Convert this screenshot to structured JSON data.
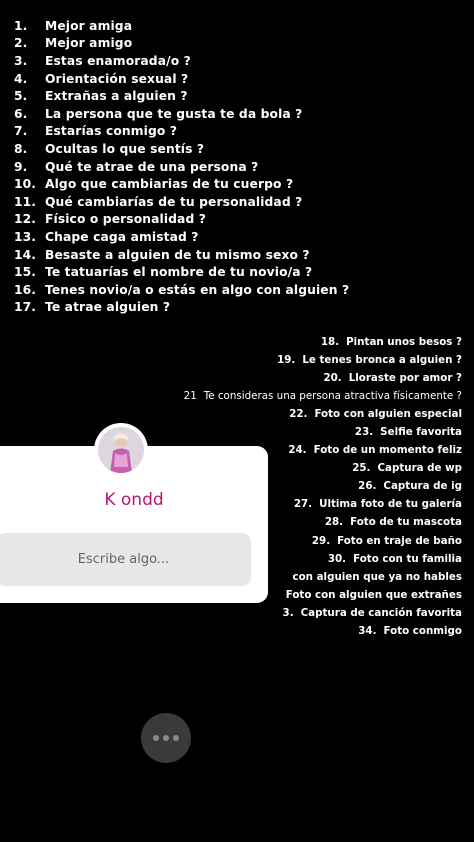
{
  "questions_left": [
    {
      "num": "1.",
      "text": "Mejor amiga"
    },
    {
      "num": "2.",
      "text": "Mejor amigo"
    },
    {
      "num": "3.",
      "text": "Estas enamorada/o ?"
    },
    {
      "num": "4.",
      "text": "Orientación sexual ?"
    },
    {
      "num": "5.",
      "text": "Extrañas a alguien ?"
    },
    {
      "num": "6.",
      "text": "La persona que te gusta te da bola ?"
    },
    {
      "num": "7.",
      "text": "Estarías conmigo ?"
    },
    {
      "num": "8.",
      "text": "Ocultas lo que sentís ?"
    },
    {
      "num": "9.",
      "text": "Qué te atrae de una persona ?"
    },
    {
      "num": "10.",
      "text": "Algo que cambiarias de tu cuerpo ?"
    },
    {
      "num": "11.",
      "text": "Qué cambiarías de tu personalidad ?"
    },
    {
      "num": "12.",
      "text": "Físico o personalidad ?"
    },
    {
      "num": "13.",
      "text": "Chape caga amistad ?"
    },
    {
      "num": "14.",
      "text": "Besaste a alguien de tu mismo sexo ?"
    },
    {
      "num": "15.",
      "text": "Te tatuarías el nombre de tu novio/a ?"
    },
    {
      "num": "16.",
      "text": "Tenes novio/a o estás en algo con alguien ?"
    },
    {
      "num": "17.",
      "text": "Te atrae alguien ?"
    }
  ],
  "questions_right": [
    {
      "num": "18.",
      "text": "Pintan unos besos ?"
    },
    {
      "num": "19.",
      "text": "Le tenes bronca a alguien ?"
    },
    {
      "num": "20.",
      "text": "Lloraste por amor ?"
    },
    {
      "num": "21",
      "text": "Te consideras una persona atractiva físicamente ?"
    },
    {
      "num": "22.",
      "text": "Foto con alguien especial"
    },
    {
      "num": "23.",
      "text": "Selfie favorita"
    },
    {
      "num": "24.",
      "text": "Foto de un momento feliz"
    },
    {
      "num": "25.",
      "text": "Captura de wp"
    },
    {
      "num": "26.",
      "text": "Captura de ig"
    },
    {
      "num": "27.",
      "text": "Ultima foto de tu galería"
    },
    {
      "num": "28.",
      "text": "Foto de tu mascota"
    },
    {
      "num": "29.",
      "text": "Foto en traje de baño"
    },
    {
      "num": "30.",
      "text": "Foto con tu familia"
    },
    {
      "num": "",
      "text": "con alguien que ya no hables"
    },
    {
      "num": "",
      "text": "Foto con alguien que extrañes"
    },
    {
      "num": "3.",
      "text": "Captura de canción favorita"
    },
    {
      "num": "34.",
      "text": "Foto conmigo"
    }
  ],
  "question_card": {
    "username": "K ondd",
    "reply_placeholder": "Escribe algo...",
    "username_color": "#b5176f"
  },
  "more_button_icon": "more-dots-icon"
}
